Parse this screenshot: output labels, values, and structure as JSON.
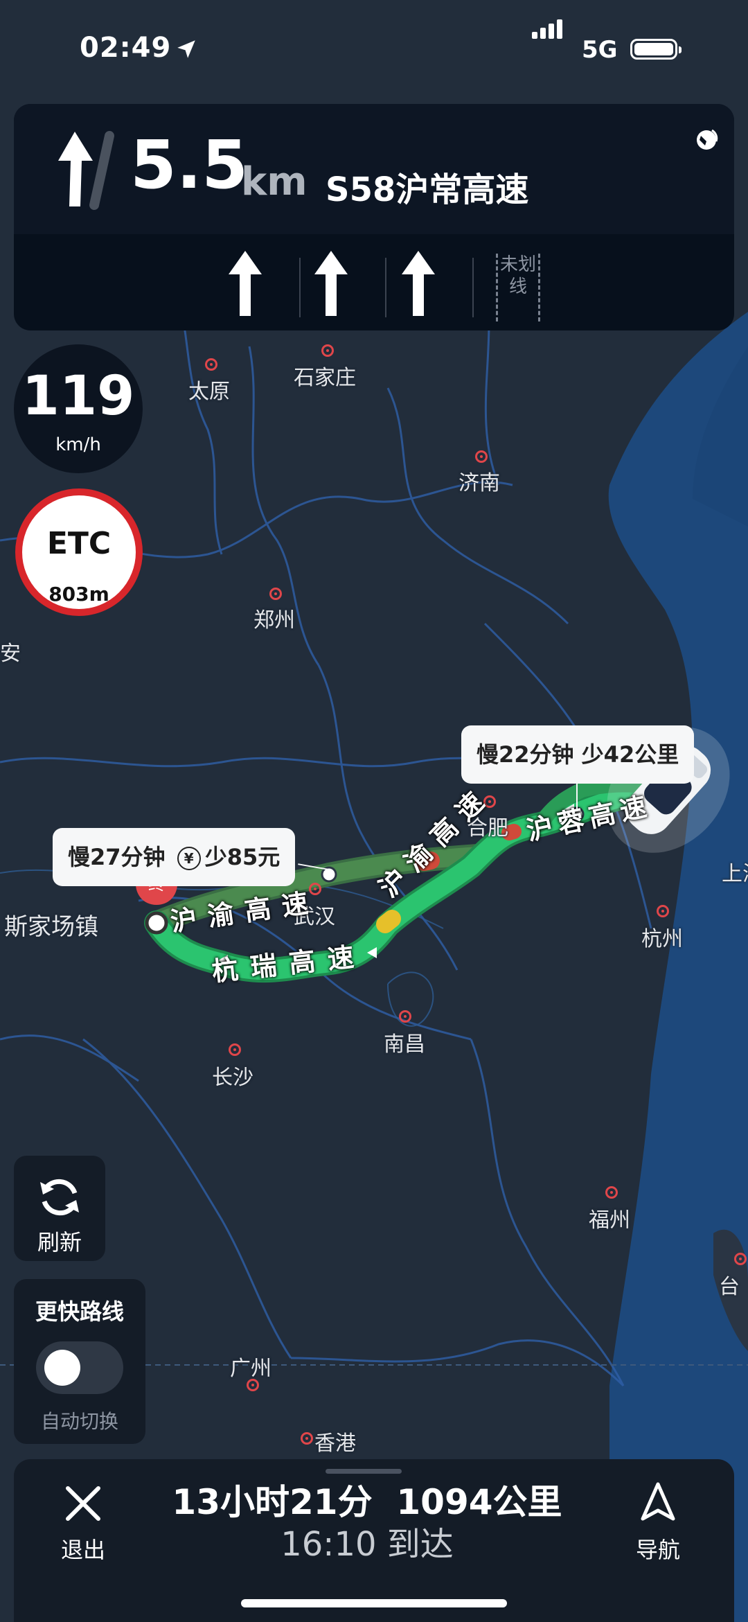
{
  "status": {
    "time": "02:49",
    "network": "5G"
  },
  "guidance": {
    "distance": "5.5",
    "unit": "km",
    "road": "S58沪常高速",
    "unmarked_lane": "未划线"
  },
  "speed": {
    "value": "119",
    "unit": "km/h"
  },
  "etc": {
    "label": "ETC",
    "distance": "803m"
  },
  "bubbles": {
    "alt_east": "慢22分钟 少42公里",
    "alt_west_time": "慢27分钟",
    "alt_west_toll": "少85元"
  },
  "cities": [
    "太原",
    "石家庄",
    "济南",
    "郑州",
    "安",
    "合肥",
    "武汉",
    "南昌",
    "杭州",
    "长沙",
    "福州",
    "广州",
    "香港",
    "台",
    "上海",
    "斯家场镇"
  ],
  "roads": {
    "hurong_west": "沪渝高速",
    "hurong_mid": "沪渝高速",
    "hangrui": "杭瑞高速",
    "hurong_east": "沪蓉高速"
  },
  "destination_marker": "终",
  "controls": {
    "refresh": "刷新",
    "faster_route": "更快路线",
    "auto_switch": "自动切换"
  },
  "bottom": {
    "exit": "退出",
    "summary": "13小时21分  1094公里",
    "arrival": "16:10 到达",
    "navigate": "导航"
  },
  "colors": {
    "route_green": "#2bb673",
    "destination": "#e0464a",
    "etc_red": "#d8262b",
    "map_bg": "#1f2a38",
    "sea": "#1e4f86"
  }
}
